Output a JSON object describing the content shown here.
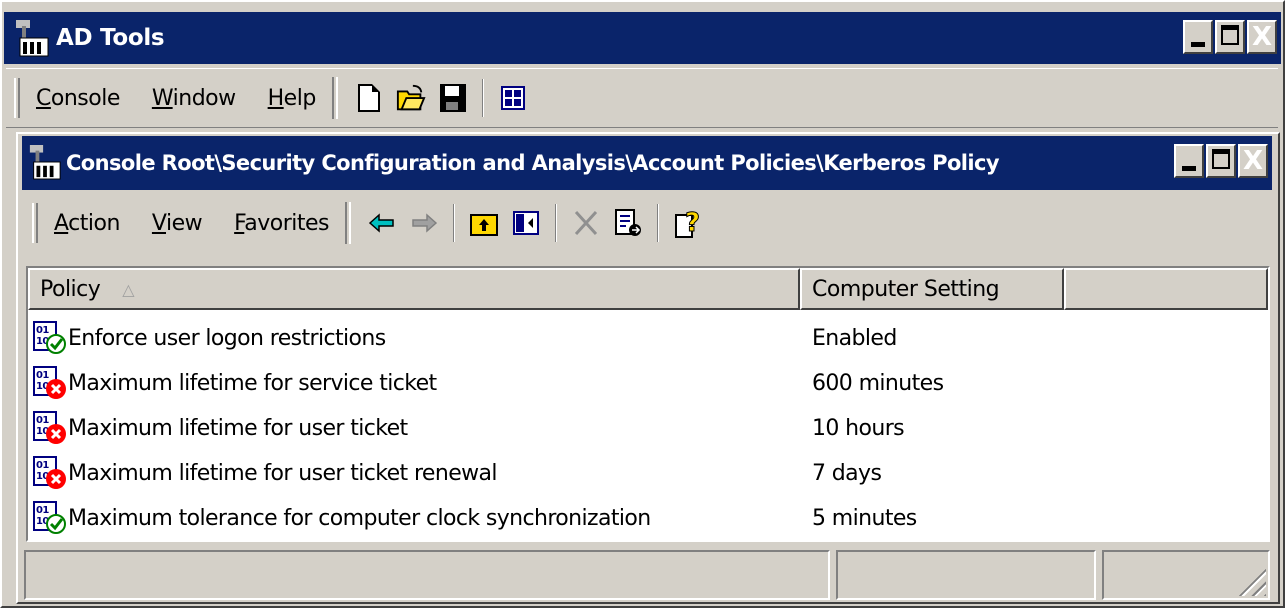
{
  "app": {
    "title": "AD Tools",
    "window_buttons": {
      "minimize": "_",
      "maximize": "□",
      "close": "X"
    }
  },
  "app_menu": {
    "items": [
      {
        "pre": "",
        "ul": "C",
        "post": "onsole"
      },
      {
        "pre": "",
        "ul": "W",
        "post": "indow"
      },
      {
        "pre": "",
        "ul": "H",
        "post": "elp"
      }
    ],
    "icons": [
      "new-document-icon",
      "open-folder-icon",
      "save-icon",
      "properties-icon"
    ]
  },
  "child": {
    "title": "Console Root\\Security Configuration and Analysis\\Account Policies\\Kerberos Policy",
    "menu": [
      {
        "pre": "",
        "ul": "A",
        "post": "ction"
      },
      {
        "pre": "",
        "ul": "V",
        "post": "iew"
      },
      {
        "pre": "",
        "ul": "F",
        "post": "avorites"
      }
    ],
    "toolbar_icons": [
      "back-arrow-icon",
      "forward-arrow-icon",
      "up-folder-icon",
      "show-hide-tree-icon",
      "delete-icon",
      "export-list-icon",
      "help-icon"
    ]
  },
  "list": {
    "columns": [
      "Policy",
      "Computer Setting",
      ""
    ],
    "sort_indicator": "△",
    "rows": [
      {
        "policy": "Enforce user logon restrictions",
        "setting": "Enabled",
        "status": "ok"
      },
      {
        "policy": "Maximum lifetime for service ticket",
        "setting": "600 minutes",
        "status": "error"
      },
      {
        "policy": "Maximum lifetime for user ticket",
        "setting": "10 hours",
        "status": "error"
      },
      {
        "policy": "Maximum lifetime for user ticket renewal",
        "setting": "7 days",
        "status": "error"
      },
      {
        "policy": "Maximum tolerance for computer clock synchronization",
        "setting": "5 minutes",
        "status": "ok"
      }
    ]
  },
  "colors": {
    "titlebar": "#0a246a",
    "face": "#d4d0c8",
    "ok_check": "#008000",
    "error_x": "#ff0000"
  }
}
